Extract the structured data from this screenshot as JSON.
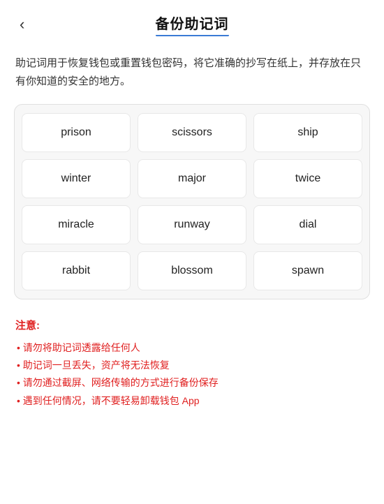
{
  "header": {
    "back_label": "‹",
    "title": "备份助记词",
    "underline": true
  },
  "description": "助记词用于恢复钱包或重置钱包密码，将它准确的抄写在纸上，并存放在只有你知道的安全的地方。",
  "mnemonic": {
    "words": [
      "prison",
      "scissors",
      "ship",
      "winter",
      "major",
      "twice",
      "miracle",
      "runway",
      "dial",
      "rabbit",
      "blossom",
      "spawn"
    ]
  },
  "notice": {
    "title": "注意:",
    "items": [
      "请勿将助记词透露给任何人",
      "助记词一旦丢失，资产将无法恢复",
      "请勿通过截屏、网络传输的方式进行备份保存",
      "遇到任何情况，请不要轻易卸载钱包 App"
    ]
  }
}
